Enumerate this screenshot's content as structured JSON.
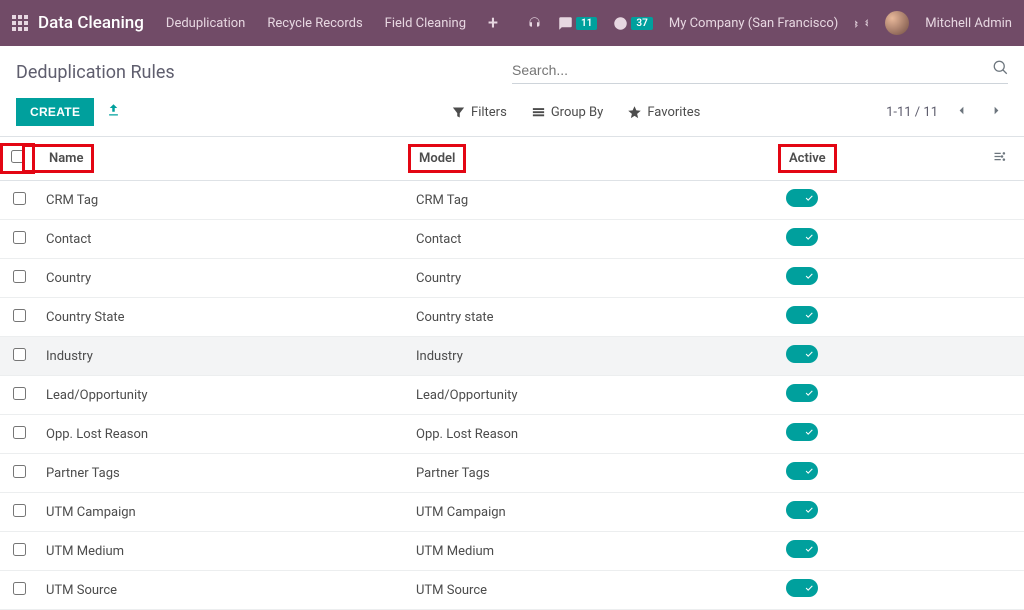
{
  "navbar": {
    "brand": "Data Cleaning",
    "menu": [
      "Deduplication",
      "Recycle Records",
      "Field Cleaning"
    ],
    "badge_messages": "11",
    "badge_activities": "37",
    "company": "My Company (San Francisco)",
    "user": "Mitchell Admin"
  },
  "control": {
    "title": "Deduplication Rules",
    "search_placeholder": "Search...",
    "create": "CREATE",
    "filters": "Filters",
    "group_by": "Group By",
    "favorites": "Favorites",
    "pager": "1-11 / 11"
  },
  "columns": {
    "name": "Name",
    "model": "Model",
    "active": "Active"
  },
  "rows": [
    {
      "name": "CRM Tag",
      "model": "CRM Tag",
      "active": true,
      "selected": false
    },
    {
      "name": "Contact",
      "model": "Contact",
      "active": true,
      "selected": false
    },
    {
      "name": "Country",
      "model": "Country",
      "active": true,
      "selected": false
    },
    {
      "name": "Country State",
      "model": "Country state",
      "active": true,
      "selected": false
    },
    {
      "name": "Industry",
      "model": "Industry",
      "active": true,
      "selected": true
    },
    {
      "name": "Lead/Opportunity",
      "model": "Lead/Opportunity",
      "active": true,
      "selected": false
    },
    {
      "name": "Opp. Lost Reason",
      "model": "Opp. Lost Reason",
      "active": true,
      "selected": false
    },
    {
      "name": "Partner Tags",
      "model": "Partner Tags",
      "active": true,
      "selected": false
    },
    {
      "name": "UTM Campaign",
      "model": "UTM Campaign",
      "active": true,
      "selected": false
    },
    {
      "name": "UTM Medium",
      "model": "UTM Medium",
      "active": true,
      "selected": false
    },
    {
      "name": "UTM Source",
      "model": "UTM Source",
      "active": true,
      "selected": false
    }
  ]
}
